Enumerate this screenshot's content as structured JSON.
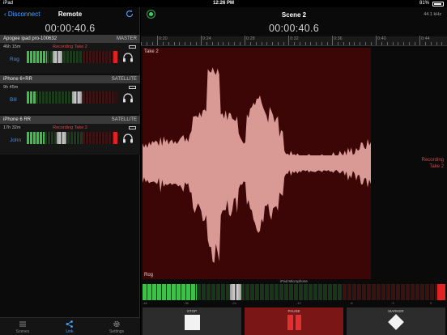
{
  "status_bar": {
    "carrier": "iPad",
    "time": "12:26 PM",
    "battery": "81%"
  },
  "left": {
    "back_label": "Disconnect",
    "title": "Remote",
    "timecode": "00:00:40.6",
    "devices": [
      {
        "name": "Apogee ipad pro-100632",
        "role": "MASTER",
        "time_left": "46h 15m",
        "status": "Recording Take 2",
        "user": "Rog",
        "level": 0.22,
        "fader": 0.32,
        "clip": true
      },
      {
        "name": "iPhone 6+RR",
        "role": "SATELLITE",
        "time_left": "9h 45m",
        "status": "",
        "user": "Bill",
        "level": 0.1,
        "fader": 0.56,
        "clip": false
      },
      {
        "name": "iPhone 6 RR",
        "role": "SATELLITE",
        "time_left": "17h 32m",
        "status": "Recording Take 2",
        "user": "John",
        "level": 0.2,
        "fader": 0.37,
        "clip": true
      }
    ],
    "tabs": [
      {
        "label": "Scenes",
        "icon": "list-icon"
      },
      {
        "label": "Link",
        "icon": "share-icon"
      },
      {
        "label": "Settings",
        "icon": "gear-icon"
      }
    ]
  },
  "right": {
    "scene_title": "Scene 2",
    "sample_rate": "44.1 kHz",
    "timecode": "00:00:40.6",
    "ruler_labels": [
      "0:20",
      "0:24",
      "0:28",
      "0:32",
      "0:36",
      "0:40",
      "0:44"
    ],
    "take_name": "Take 2",
    "take_user": "Rog",
    "recording_line1": "Recording",
    "recording_line2": "Take 2",
    "input_label": "iPad Microphone",
    "meter_level": 0.18,
    "meter_fader": 0.3,
    "scale_labels": [
      "-48",
      "-36",
      "-24",
      "-12",
      "-6",
      "-3",
      "0"
    ],
    "transport": {
      "stop": "STOP",
      "pause": "PAUSE",
      "marker": "MARKER"
    },
    "colors": {
      "accent": "#4aa3ff",
      "record_red": "#d84848",
      "waveform": "#d99a96",
      "take_bg": "#3c0606",
      "meter_green": "#3cc04a"
    }
  }
}
